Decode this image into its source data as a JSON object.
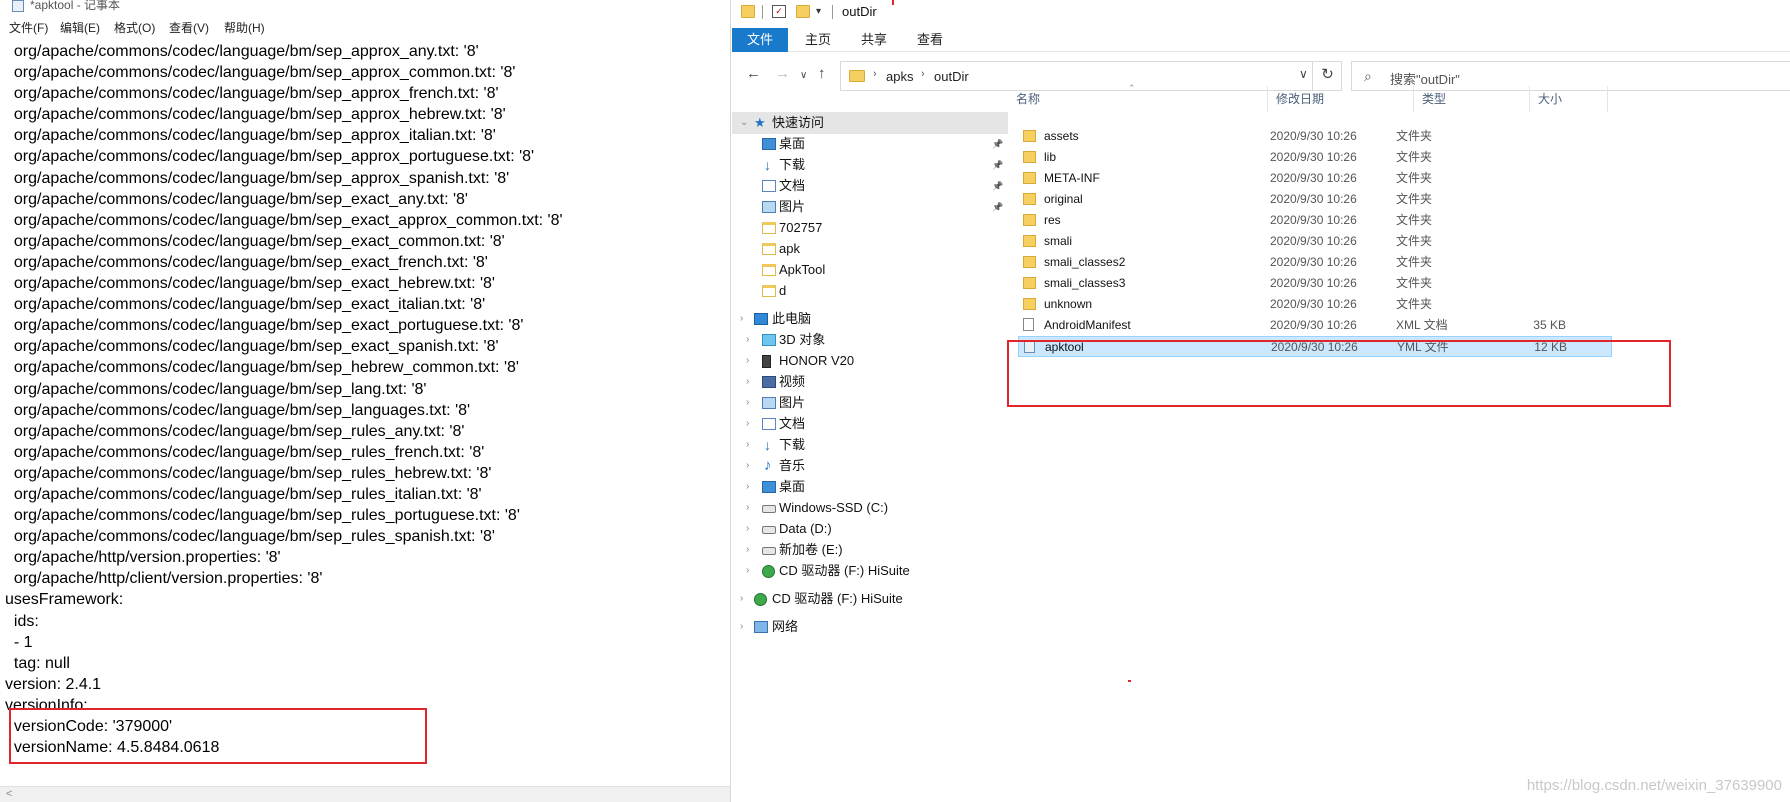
{
  "notepad": {
    "title": "*apktool - 记事本",
    "menu": [
      "文件(F)",
      "编辑(E)",
      "格式(O)",
      "查看(V)",
      "帮助(H)"
    ],
    "lines": [
      "  org/apache/commons/codec/language/bm/sep_approx_any.txt: '8'",
      "  org/apache/commons/codec/language/bm/sep_approx_common.txt: '8'",
      "  org/apache/commons/codec/language/bm/sep_approx_french.txt: '8'",
      "  org/apache/commons/codec/language/bm/sep_approx_hebrew.txt: '8'",
      "  org/apache/commons/codec/language/bm/sep_approx_italian.txt: '8'",
      "  org/apache/commons/codec/language/bm/sep_approx_portuguese.txt: '8'",
      "  org/apache/commons/codec/language/bm/sep_approx_spanish.txt: '8'",
      "  org/apache/commons/codec/language/bm/sep_exact_any.txt: '8'",
      "  org/apache/commons/codec/language/bm/sep_exact_approx_common.txt: '8'",
      "  org/apache/commons/codec/language/bm/sep_exact_common.txt: '8'",
      "  org/apache/commons/codec/language/bm/sep_exact_french.txt: '8'",
      "  org/apache/commons/codec/language/bm/sep_exact_hebrew.txt: '8'",
      "  org/apache/commons/codec/language/bm/sep_exact_italian.txt: '8'",
      "  org/apache/commons/codec/language/bm/sep_exact_portuguese.txt: '8'",
      "  org/apache/commons/codec/language/bm/sep_exact_spanish.txt: '8'",
      "  org/apache/commons/codec/language/bm/sep_hebrew_common.txt: '8'",
      "  org/apache/commons/codec/language/bm/sep_lang.txt: '8'",
      "  org/apache/commons/codec/language/bm/sep_languages.txt: '8'",
      "  org/apache/commons/codec/language/bm/sep_rules_any.txt: '8'",
      "  org/apache/commons/codec/language/bm/sep_rules_french.txt: '8'",
      "  org/apache/commons/codec/language/bm/sep_rules_hebrew.txt: '8'",
      "  org/apache/commons/codec/language/bm/sep_rules_italian.txt: '8'",
      "  org/apache/commons/codec/language/bm/sep_rules_portuguese.txt: '8'",
      "  org/apache/commons/codec/language/bm/sep_rules_spanish.txt: '8'",
      "  org/apache/http/version.properties: '8'",
      "  org/apache/http/client/version.properties: '8'",
      "usesFramework:",
      "  ids:",
      "  - 1",
      "  tag: null",
      "version: 2.4.1",
      "versionInfo:",
      "  versionCode: '379000'",
      "  versionName: 4.5.8484.0618"
    ]
  },
  "explorer": {
    "title": "outDir",
    "ribbon_tabs": [
      "文件",
      "主页",
      "共享",
      "查看"
    ],
    "breadcrumb": [
      "apks",
      "outDir"
    ],
    "search_placeholder": "搜索\"outDir\"",
    "nav_pane": [
      {
        "label": "快速访问",
        "icon": "star-icon",
        "level": 0,
        "selected": true
      },
      {
        "label": "桌面",
        "icon": "desktop-icon",
        "level": 1,
        "pinned": true
      },
      {
        "label": "下载",
        "icon": "download-icon",
        "level": 1,
        "pinned": true
      },
      {
        "label": "文档",
        "icon": "document-icon",
        "level": 1,
        "pinned": true
      },
      {
        "label": "图片",
        "icon": "picture-icon",
        "level": 1,
        "pinned": true
      },
      {
        "label": "702757",
        "icon": "folder-icon",
        "level": 1
      },
      {
        "label": "apk",
        "icon": "folder-icon",
        "level": 1
      },
      {
        "label": "ApkTool",
        "icon": "folder-icon",
        "level": 1
      },
      {
        "label": "d",
        "icon": "folder-icon",
        "level": 1
      },
      {
        "label": "此电脑",
        "icon": "computer-icon",
        "level": 0
      },
      {
        "label": "3D 对象",
        "icon": "3d-objects-icon",
        "level": 1
      },
      {
        "label": "HONOR V20",
        "icon": "phone-icon",
        "level": 1
      },
      {
        "label": "视频",
        "icon": "video-icon",
        "level": 1
      },
      {
        "label": "图片",
        "icon": "picture-icon",
        "level": 1
      },
      {
        "label": "文档",
        "icon": "document-icon",
        "level": 1
      },
      {
        "label": "下载",
        "icon": "download-icon",
        "level": 1
      },
      {
        "label": "音乐",
        "icon": "music-icon",
        "level": 1
      },
      {
        "label": "桌面",
        "icon": "desktop-icon",
        "level": 1
      },
      {
        "label": "Windows-SSD (C:)",
        "icon": "drive-icon",
        "level": 1
      },
      {
        "label": "Data (D:)",
        "icon": "drive-icon",
        "level": 1
      },
      {
        "label": "新加卷 (E:)",
        "icon": "drive-icon",
        "level": 1
      },
      {
        "label": "CD 驱动器 (F:) HiSuite",
        "icon": "cd-drive-icon",
        "level": 1
      },
      {
        "label": "CD 驱动器 (F:) HiSuite",
        "icon": "cd-drive-icon",
        "level": 0
      },
      {
        "label": "网络",
        "icon": "network-icon",
        "level": 0
      }
    ],
    "columns": [
      "名称",
      "修改日期",
      "类型",
      "大小"
    ],
    "files": [
      {
        "name": "assets",
        "date": "2020/9/30 10:26",
        "type": "文件夹",
        "size": "",
        "icon": "folder-icon"
      },
      {
        "name": "lib",
        "date": "2020/9/30 10:26",
        "type": "文件夹",
        "size": "",
        "icon": "folder-icon"
      },
      {
        "name": "META-INF",
        "date": "2020/9/30 10:26",
        "type": "文件夹",
        "size": "",
        "icon": "folder-icon"
      },
      {
        "name": "original",
        "date": "2020/9/30 10:26",
        "type": "文件夹",
        "size": "",
        "icon": "folder-icon"
      },
      {
        "name": "res",
        "date": "2020/9/30 10:26",
        "type": "文件夹",
        "size": "",
        "icon": "folder-icon"
      },
      {
        "name": "smali",
        "date": "2020/9/30 10:26",
        "type": "文件夹",
        "size": "",
        "icon": "folder-icon"
      },
      {
        "name": "smali_classes2",
        "date": "2020/9/30 10:26",
        "type": "文件夹",
        "size": "",
        "icon": "folder-icon"
      },
      {
        "name": "smali_classes3",
        "date": "2020/9/30 10:26",
        "type": "文件夹",
        "size": "",
        "icon": "folder-icon"
      },
      {
        "name": "unknown",
        "date": "2020/9/30 10:26",
        "type": "文件夹",
        "size": "",
        "icon": "folder-icon"
      },
      {
        "name": "AndroidManifest",
        "date": "2020/9/30 10:26",
        "type": "XML 文档",
        "size": "35 KB",
        "icon": "file-icon"
      },
      {
        "name": "apktool",
        "date": "2020/9/30 10:26",
        "type": "YML 文件",
        "size": "12 KB",
        "icon": "yml-file-icon",
        "selected": true
      }
    ]
  },
  "watermark": "https://blog.csdn.net/weixin_37639900",
  "colors": {
    "highlight_red": "#e0262a",
    "ribbon_blue": "#1979ca",
    "selection": "#cce8ff"
  }
}
